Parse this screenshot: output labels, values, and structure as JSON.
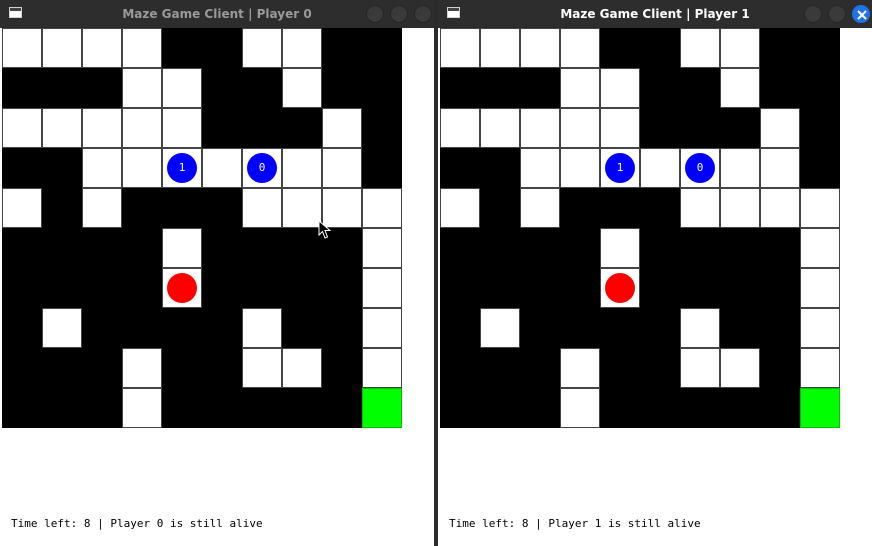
{
  "colors": {
    "wall": "#000000",
    "path": "#ffffff",
    "goal": "#00ff00",
    "enemy": "#ff0000",
    "player": "#0000ff",
    "titlebar": "#2d2d2d",
    "title_active": "#ffffff",
    "title_inactive": "#9a9a9a"
  },
  "maze": {
    "rows": [
      "1111001100",
      "0001100100",
      "1111100010",
      "0011111110",
      "1010001111",
      "0000100001",
      "0000100001",
      "0100001001",
      "0001001101",
      "000100000G"
    ],
    "enemies": [
      {
        "row": 6,
        "col": 4
      }
    ],
    "players": [
      {
        "row": 3,
        "col": 4,
        "label": "1"
      },
      {
        "row": 3,
        "col": 6,
        "label": "0"
      }
    ]
  },
  "windows": [
    {
      "title": "Maze Game Client | Player 0",
      "active": false,
      "status": "Time left: 8 | Player 0 is still alive",
      "icons": [
        "window-icon",
        "minimize-icon",
        "maximize-icon",
        "close-icon"
      ]
    },
    {
      "title": "Maze Game Client | Player 1",
      "active": true,
      "status": "Time left: 8 | Player 1 is still alive",
      "icons": [
        "window-icon",
        "minimize-icon",
        "maximize-icon",
        "close-icon"
      ]
    }
  ],
  "cursor": {
    "icon": "mouse-pointer-icon"
  }
}
